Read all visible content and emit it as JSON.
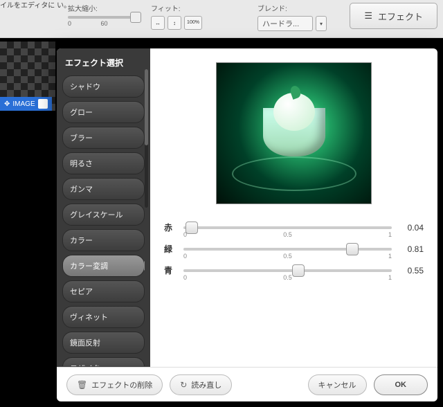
{
  "toolbar": {
    "left_fragment": "イルをエディタに\nい。",
    "zoom_label": "拡大縮小:",
    "zoom_tick_min": "0",
    "zoom_tick_mid": "60",
    "fit_label": "フィット:",
    "fit_pct": "100%",
    "blend_label": "ブレンド:",
    "blend_value": "ハードラ...",
    "effect_btn": "エフェクト"
  },
  "image_chip": "IMAGE",
  "dialog": {
    "sidebar_title": "エフェクト選択",
    "items": [
      "シャドウ",
      "グロー",
      "ブラー",
      "明るさ",
      "ガンマ",
      "グレイスケール",
      "カラー",
      "カラー変調",
      "セピア",
      "ヴィネット",
      "鏡面反射",
      "モザイク"
    ],
    "selected_index": 7,
    "slider_ticks": {
      "min": "0",
      "mid": "0.5",
      "max": "1"
    },
    "sliders": [
      {
        "name": "赤",
        "value": 0.04,
        "display": "0.04"
      },
      {
        "name": "緑",
        "value": 0.81,
        "display": "0.81"
      },
      {
        "name": "青",
        "value": 0.55,
        "display": "0.55"
      }
    ],
    "footer": {
      "delete": "エフェクトの削除",
      "reset": "読み直し",
      "cancel": "キャンセル",
      "ok": "OK"
    }
  }
}
